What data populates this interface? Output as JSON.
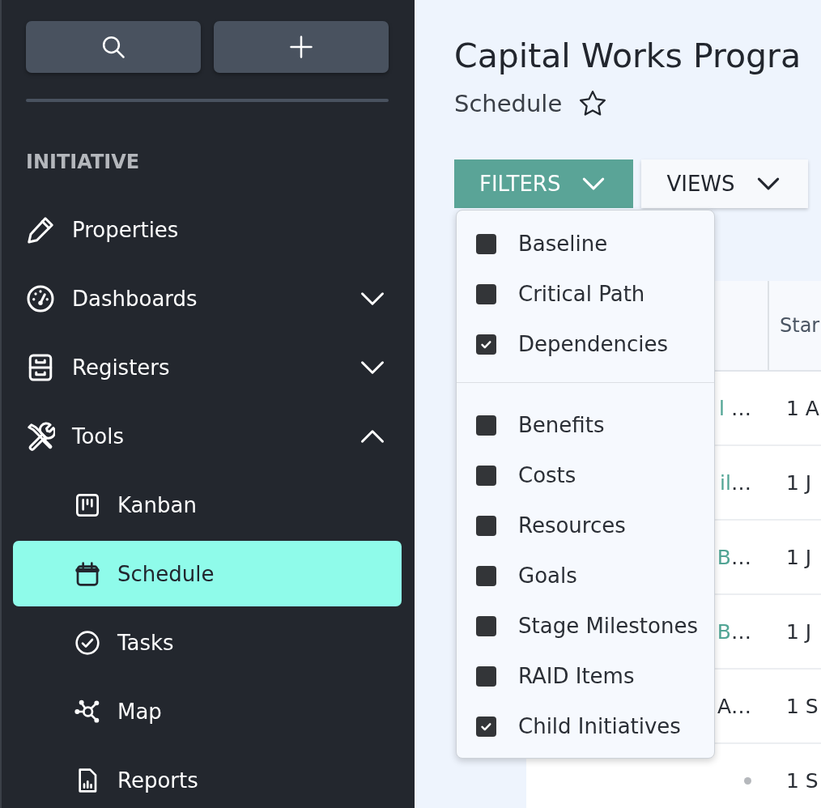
{
  "sidebar": {
    "actions": [
      {
        "kind": "search"
      },
      {
        "kind": "add"
      }
    ],
    "section": "INITIATIVE",
    "items": [
      {
        "label": "Properties",
        "selected": false
      },
      {
        "label": "Dashboards",
        "selected": false,
        "expanded": false
      },
      {
        "label": "Registers",
        "selected": false,
        "expanded": false
      },
      {
        "label": "Tools",
        "selected": false,
        "expanded": true,
        "children": [
          {
            "label": "Kanban",
            "selected": false
          },
          {
            "label": "Schedule",
            "selected": true
          },
          {
            "label": "Tasks",
            "selected": false
          },
          {
            "label": "Map",
            "selected": false
          },
          {
            "label": "Reports",
            "selected": false
          }
        ]
      }
    ]
  },
  "header": {
    "title": "Capital Works Progra",
    "subtitle": "Schedule",
    "favorite": false
  },
  "toolbar": [
    {
      "label": "FILTERS",
      "expanded": true
    },
    {
      "label": "VIEWS",
      "expanded": false
    }
  ],
  "filters_menu": {
    "groups": [
      {
        "items": [
          {
            "label": "Baseline",
            "checked": false
          },
          {
            "label": "Critical Path",
            "checked": false
          },
          {
            "label": "Dependencies",
            "checked": true
          }
        ]
      },
      {
        "items": [
          {
            "label": "Benefits",
            "checked": false
          },
          {
            "label": "Costs",
            "checked": false
          },
          {
            "label": "Resources",
            "checked": false
          },
          {
            "label": "Goals",
            "checked": false
          },
          {
            "label": "Stage Milestones",
            "checked": false
          },
          {
            "label": "RAID Items",
            "checked": false
          },
          {
            "label": "Child Initiatives",
            "checked": true
          }
        ]
      }
    ]
  },
  "table": {
    "header": {
      "column_2": "Star"
    },
    "rows": [
      {
        "column_1": {
          "kind": "link",
          "link": "l",
          "tail": " …"
        },
        "column_2": "1 A"
      },
      {
        "column_1": {
          "kind": "link",
          "link": "il",
          "tail": "…"
        },
        "column_2": "1 J"
      },
      {
        "column_1": {
          "kind": "link",
          "link": "B",
          "tail": "…"
        },
        "column_2": "1 J"
      },
      {
        "column_1": {
          "kind": "link",
          "link": "B",
          "tail": "…"
        },
        "column_2": "1 J"
      },
      {
        "column_1": {
          "kind": "text",
          "text": "A…"
        },
        "column_2": "1 S"
      },
      {
        "column_1": {
          "kind": "dot"
        },
        "column_2": "1 S"
      }
    ]
  }
}
